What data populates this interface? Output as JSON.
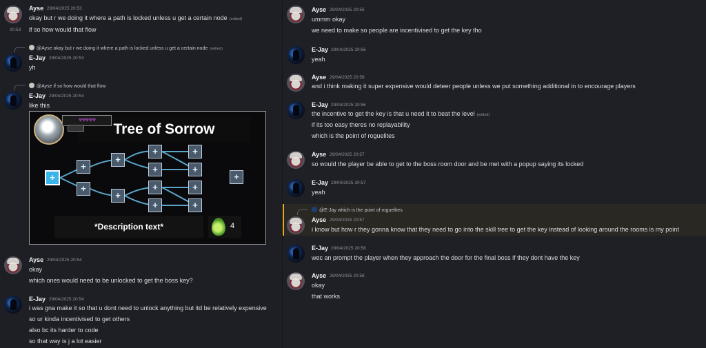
{
  "users": {
    "ayse": "Ayse",
    "ejay": "E-Jay"
  },
  "edited_label": "(edited)",
  "left": {
    "m1": {
      "user": "Ayse",
      "time": "29/04/2025 20:53",
      "lines": [
        "okay but r we doing it where a path is locked unless u get a certain node"
      ],
      "followup_time": "20:53",
      "followup": "if so how would that flow"
    },
    "m2": {
      "reply_text": "@Ayse okay but r we doing it where a path is locked unless u get a certain node",
      "user": "E-Jay",
      "time": "29/04/2025 20:53",
      "lines": [
        "yh"
      ]
    },
    "m3": {
      "reply_text": "@Ayse if so how would that flow",
      "user": "E-Jay",
      "time": "29/04/2025 20:54",
      "lines": [
        "like this"
      ]
    },
    "skill_tree": {
      "title": "Tree of Sorrow",
      "hearts": "♥♥♥♥♥",
      "description": "*Description text*",
      "currency_count": "4",
      "node_icon": "+"
    },
    "m4": {
      "user": "Ayse",
      "time": "29/04/2025 20:54",
      "lines": [
        "okay",
        "which ones would need to be unlocked to get the boss key?"
      ]
    },
    "m5": {
      "user": "E-Jay",
      "time": "29/04/2025 20:54",
      "lines": [
        "i was gna make it so that u dont need to unlock anything but itd be relatively expensive",
        "so ur kinda incentivised to get others",
        "also bc its harder to code",
        "so that way is j a lot easier"
      ]
    }
  },
  "right": {
    "r1": {
      "user": "Ayse",
      "time": "29/04/2025 20:55",
      "lines": [
        "ummm okay",
        "we need to make so people are incentivised to get the key tho"
      ]
    },
    "r2": {
      "user": "E-Jay",
      "time": "29/04/2025 20:56",
      "lines": [
        "yeah"
      ]
    },
    "r3": {
      "user": "Ayse",
      "time": "29/04/2025 20:56",
      "lines": [
        "and i think making it super expensive would deteer people unless we put something additional in to encourage players"
      ]
    },
    "r4": {
      "user": "E-Jay",
      "time": "29/04/2025 20:56",
      "lines": [
        "the incentive to get the key is that u need it to beat the level",
        "if its too easy theres no replayability",
        "which is the point of roguelites"
      ]
    },
    "r5": {
      "user": "Ayse",
      "time": "29/04/2025 20:57",
      "lines": [
        "so would the player be able to get to the boss room door and be met with a popup saying its locked"
      ]
    },
    "r6": {
      "user": "E-Jay",
      "time": "29/04/2025 20:57",
      "lines": [
        "yeah"
      ]
    },
    "r7": {
      "reply_text": "@E-Jay which is the point of roguelites",
      "user": "Ayse",
      "time": "29/04/2025 20:57",
      "lines": [
        "i know but how r they gonna know that they need to go into the skill tree to get the key instead of looking around the rooms is my point"
      ]
    },
    "r8": {
      "user": "E-Jay",
      "time": "29/04/2025 20:58",
      "lines": [
        "wec an prompt the player when they approach the door for the final boss if they dont have the key"
      ]
    },
    "r9": {
      "user": "Ayse",
      "time": "29/04/2025 20:58",
      "lines": [
        "okay",
        "that works"
      ]
    }
  }
}
